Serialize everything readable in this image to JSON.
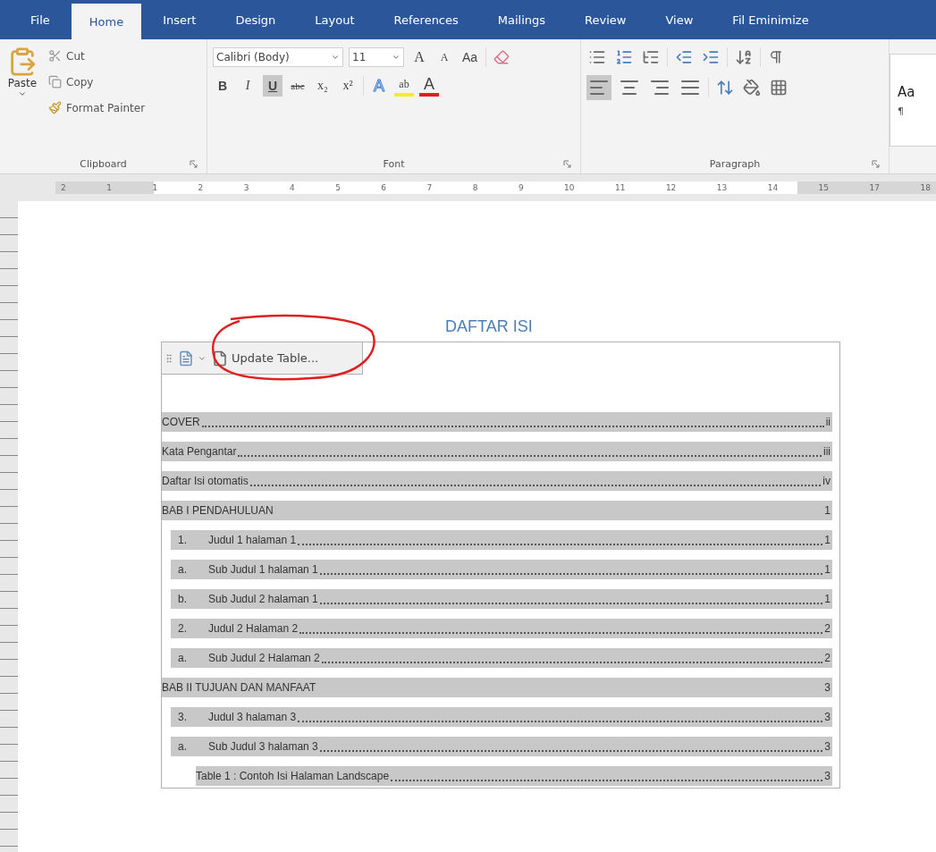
{
  "tabs": [
    {
      "label": "File",
      "selected": false
    },
    {
      "label": "Home",
      "selected": true
    },
    {
      "label": "Insert",
      "selected": false
    },
    {
      "label": "Design",
      "selected": false
    },
    {
      "label": "Layout",
      "selected": false
    },
    {
      "label": "References",
      "selected": false
    },
    {
      "label": "Mailings",
      "selected": false
    },
    {
      "label": "Review",
      "selected": false
    },
    {
      "label": "View",
      "selected": false
    },
    {
      "label": "Fil Eminimize",
      "selected": false
    }
  ],
  "clipboard": {
    "paste": "Paste",
    "items": [
      {
        "kind": "cut",
        "label": "Cut"
      },
      {
        "kind": "copy",
        "label": "Copy"
      },
      {
        "kind": "painter",
        "label": "Format Painter"
      }
    ],
    "group": "Clipboard"
  },
  "font": {
    "name": "Calibri (Body)",
    "size": "11",
    "top_buttons": [
      {
        "kind": "grow",
        "label": "A"
      },
      {
        "kind": "shrink",
        "label": "A"
      },
      {
        "kind": "case",
        "label": "Aa"
      }
    ],
    "format_buttons": [
      {
        "kind": "bold",
        "label": "B",
        "selected": false
      },
      {
        "kind": "italic",
        "label": "I",
        "selected": false
      },
      {
        "kind": "underline",
        "label": "U",
        "selected": true
      },
      {
        "kind": "strike",
        "label": "abc",
        "selected": false
      },
      {
        "kind": "sub",
        "label": "x₂",
        "selected": false
      },
      {
        "kind": "sup",
        "label": "x²",
        "selected": false
      }
    ],
    "color_buttons": [
      {
        "kind": "effects",
        "label": "A"
      },
      {
        "kind": "highlight",
        "label": "ab"
      },
      {
        "kind": "color",
        "label": "A"
      }
    ],
    "group": "Font"
  },
  "paragraph": {
    "alignments": [
      {
        "kind": "left",
        "selected": true
      },
      {
        "kind": "center",
        "selected": false
      },
      {
        "kind": "right",
        "selected": false
      },
      {
        "kind": "justify",
        "selected": false
      }
    ],
    "group": "Paragraph"
  },
  "styles": {
    "sample": "Aa",
    "name": "¶"
  },
  "ruler": [
    "2",
    "1",
    "1",
    "2",
    "3",
    "4",
    "5",
    "6",
    "7",
    "8",
    "9",
    "10",
    "11",
    "12",
    "13",
    "14",
    "15",
    "17",
    "18"
  ],
  "document": {
    "heading": "DAFTAR ISI",
    "update_button": "Update Table...",
    "toc": [
      {
        "kind": "heading",
        "title": "COVER",
        "page": "ii"
      },
      {
        "kind": "heading",
        "title": "Kata Pengantar",
        "page": "iii"
      },
      {
        "kind": "heading",
        "title": "Daftar Isi otomatis",
        "page": "iv"
      },
      {
        "kind": "heading",
        "title": "BAB I PENDAHULUAN",
        "page": "1",
        "children": [
          {
            "kind": "sub",
            "number": "1.",
            "title": "Judul 1 halaman 1",
            "page": "1"
          },
          {
            "kind": "sub",
            "number": "a.",
            "title": "Sub Judul 1 halaman 1",
            "page": "1"
          },
          {
            "kind": "sub",
            "number": "b.",
            "title": "Sub Judul 2 halaman 1",
            "page": "1"
          },
          {
            "kind": "sub",
            "number": "2.",
            "title": "Judul 2 Halaman 2",
            "page": "2"
          },
          {
            "kind": "sub",
            "number": "a.",
            "title": "Sub Judul 2 Halaman 2",
            "page": "2"
          }
        ]
      },
      {
        "kind": "heading",
        "title": "BAB II TUJUAN DAN MANFAAT",
        "page": "3",
        "children": [
          {
            "kind": "sub",
            "number": "3.",
            "title": "Judul 3 halaman 3",
            "page": "3"
          },
          {
            "kind": "sub",
            "number": "a.",
            "title": "Sub Judul 3 halaman 3",
            "page": "3"
          },
          {
            "kind": "caption",
            "title": "Table 1 : Contoh Isi Halaman Landscape",
            "page": "3"
          }
        ]
      }
    ]
  }
}
